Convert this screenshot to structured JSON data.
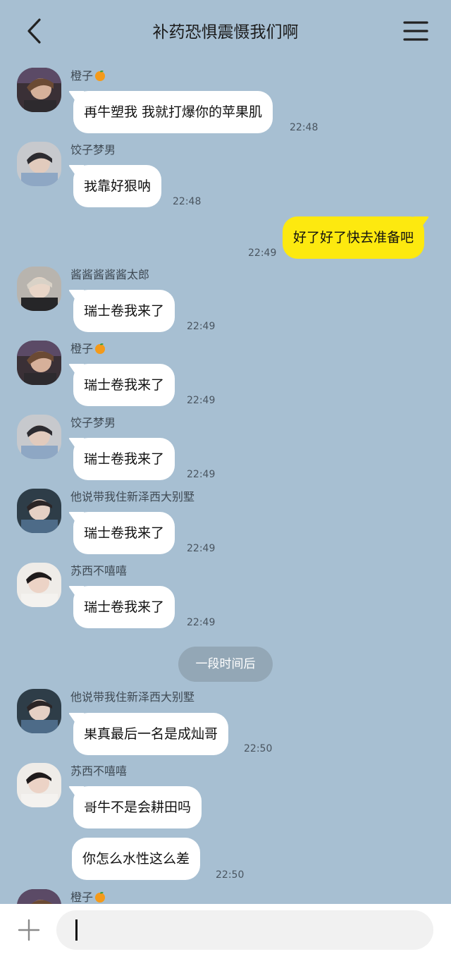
{
  "header": {
    "title": "补药恐惧震慑我们啊",
    "back_icon": "chevron-left-icon",
    "menu_icon": "hamburger-menu-icon"
  },
  "messages": [
    {
      "sender": "橙子",
      "emoji": "orange",
      "text": "再牛塑我 我就打爆你的苹果肌",
      "time": "22:48"
    },
    {
      "sender": "饺子梦男",
      "text": "我靠好狠呐",
      "time": "22:48"
    },
    {
      "outgoing": true,
      "text": "好了好了快去准备吧",
      "time": "22:49"
    },
    {
      "sender": "酱酱酱酱酱太郎",
      "text": "瑞士卷我来了",
      "time": "22:49"
    },
    {
      "sender": "橙子",
      "emoji": "orange",
      "text": "瑞士卷我来了",
      "time": "22:49"
    },
    {
      "sender": "饺子梦男",
      "text": "瑞士卷我来了",
      "time": "22:49"
    },
    {
      "sender": "他说带我住新泽西大别墅",
      "text": "瑞士卷我来了",
      "time": "22:49"
    },
    {
      "sender": "苏西不嘻嘻",
      "text": "瑞士卷我来了",
      "time": "22:49"
    },
    {
      "sender": "他说带我住新泽西大别墅",
      "text": "果真最后一名是成灿哥",
      "time": "22:50"
    },
    {
      "sender": "苏西不嘻嘻",
      "text": "哥牛不是会耕田吗",
      "text2": "你怎么水性这么差",
      "time": "22:50"
    },
    {
      "sender": "橙子",
      "emoji": "orange"
    }
  ],
  "divider": {
    "text": "一段时间后"
  },
  "input": {
    "plus_icon": "plus-icon",
    "placeholder": ""
  },
  "colors": {
    "background": "#a7bfd2",
    "outgoing_bubble": "#fde90f",
    "incoming_bubble": "#ffffff"
  }
}
